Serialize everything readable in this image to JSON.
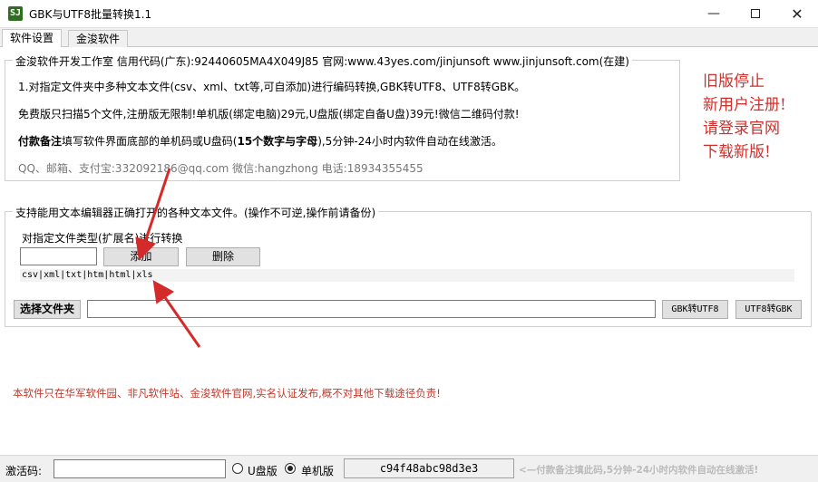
{
  "window": {
    "icon_text": "SJ",
    "title": "GBK与UTF8批量转换1.1",
    "minimize": "—",
    "close": "✕"
  },
  "tabs": [
    {
      "label": "软件设置",
      "active": true
    },
    {
      "label": "金浚软件",
      "active": false
    }
  ],
  "info": {
    "legend": "金浚软件开发工作室 信用代码(广东):92440605MA4X049J85 官网:www.43yes.com/jinjunsoft  www.jinjunsoft.com(在建)",
    "line1": "1.对指定文件夹中多种文本文件(csv、xml、txt等,可自添加)进行编码转换,GBK转UTF8、UTF8转GBK。",
    "line2": "免费版只扫描5个文件,注册版无限制!单机版(绑定电脑)29元,U盘版(绑定自备U盘)39元!微信二维码付款!",
    "line3_bold": "付款备注",
    "line3_rest": "填写软件界面底部的单机码或U盘码(",
    "line3_bold2": "15个数字与字母",
    "line3_end": "),5分钟-24小时内软件自动在线激活。",
    "contact": "QQ、邮箱、支付宝:332092186@qq.com    微信:hangzhong    电话:18934355455"
  },
  "notice": {
    "lines": [
      "旧版停止",
      "新用户注册!",
      "请登录官网",
      "下载新版!"
    ],
    "color": "#d0302b"
  },
  "convert": {
    "legend": "支持能用文本编辑器正确打开的各种文本文件。(操作不可逆,操作前请备份)",
    "filetype_label": "对指定文件类型(扩展名)进行转换",
    "ext_input_value": "",
    "add_button": "添加",
    "delete_button": "删除",
    "ext_list": "csv|xml|txt|htm|html|xls",
    "select_folder_button": "选择文件夹",
    "folder_path_value": "",
    "gbk_to_utf8_button": "GBK转UTF8",
    "utf8_to_gbk_button": "UTF8转GBK"
  },
  "disclaimer": "本软件只在华军软件园、非凡软件站、金浚软件官网,实名认证发布,概不对其他下载途径负责!",
  "statusbar": {
    "activation_label": "激活码:",
    "activation_value": "",
    "usb_label": "U盘版",
    "usb_checked": false,
    "standalone_label": "单机版",
    "standalone_checked": true,
    "machine_code": "c94f48abc98d3e3",
    "hint": "<—付款备注填此码,5分钟-24小时内软件自动在线激活!"
  },
  "colors": {
    "arrow": "#d42a2a",
    "disclaimer": "#c0392b"
  }
}
